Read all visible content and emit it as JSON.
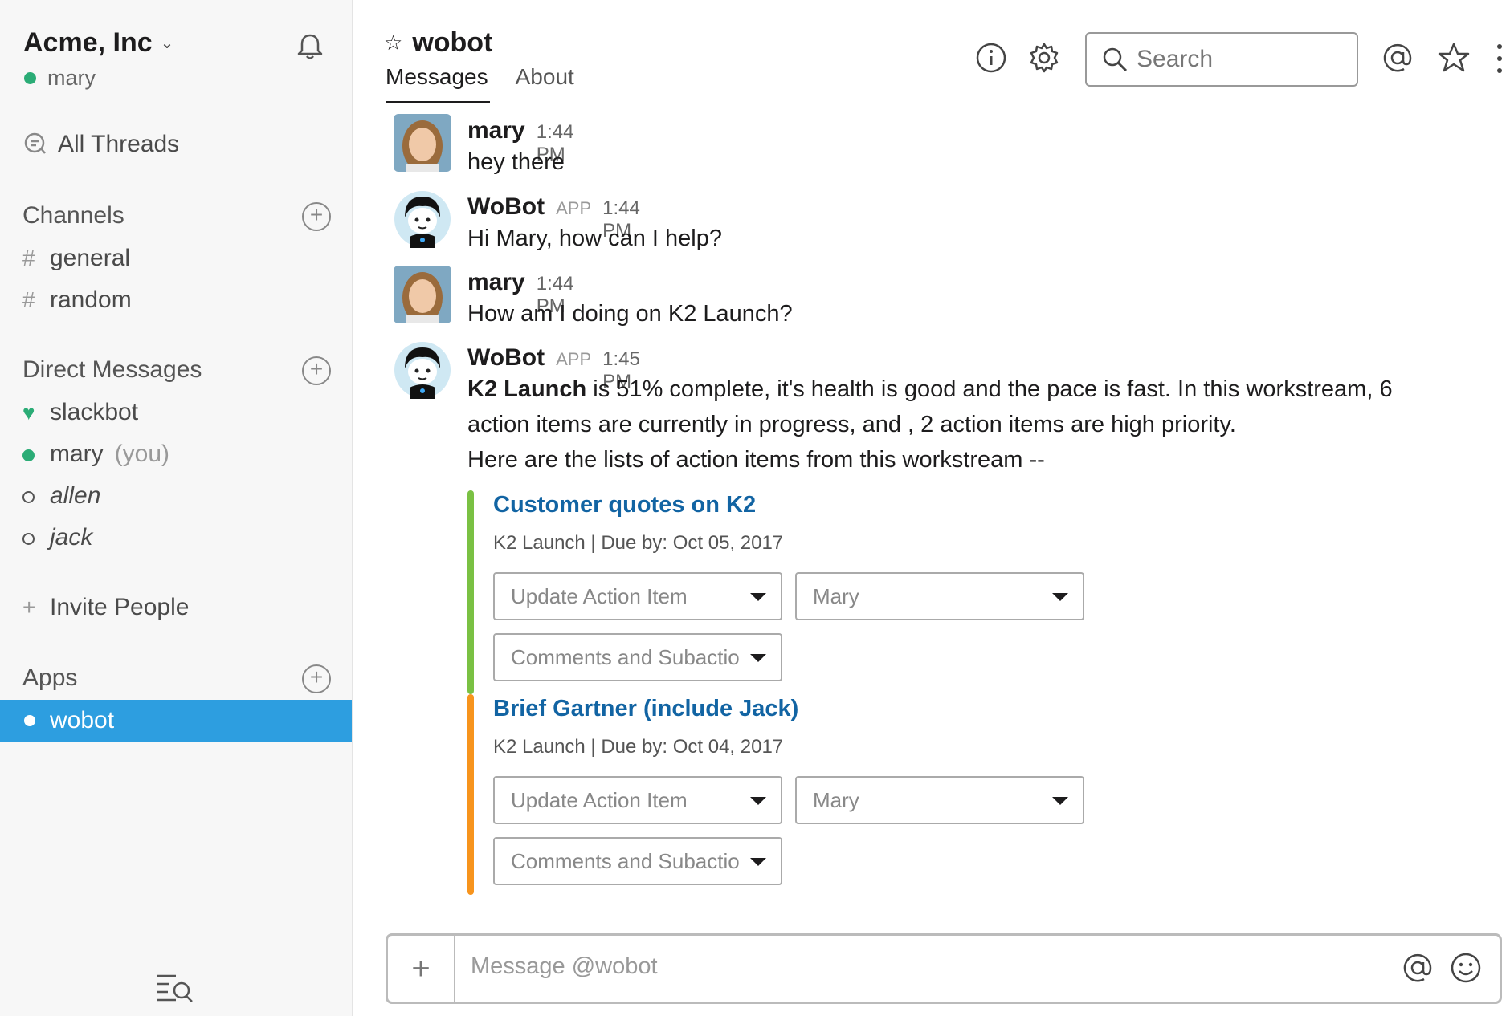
{
  "sidebar": {
    "team_name": "Acme, Inc",
    "team_chevron": "chevron-down-icon",
    "current_user": "mary",
    "all_threads": "All Threads",
    "channels_heading": "Channels",
    "channels": [
      {
        "prefix": "#",
        "name": "general"
      },
      {
        "prefix": "#",
        "name": "random"
      }
    ],
    "dm_heading": "Direct Messages",
    "direct_messages": [
      {
        "name": "slackbot",
        "status": "heart"
      },
      {
        "name": "mary",
        "suffix": "(you)",
        "status": "online"
      },
      {
        "name": "allen",
        "status": "away"
      },
      {
        "name": "jack",
        "status": "away"
      }
    ],
    "invite": "Invite People",
    "invite_prefix": "+",
    "apps_heading": "Apps",
    "apps": [
      {
        "name": "wobot",
        "active": true
      }
    ],
    "colors": {
      "active_bg": "#2d9ee0",
      "online": "#2bac76"
    }
  },
  "header": {
    "channel_name": "wobot",
    "star_glyph": "☆",
    "tabs": [
      {
        "label": "Messages",
        "active": true
      },
      {
        "label": "About",
        "active": false
      }
    ],
    "search_placeholder": "Search",
    "icons": [
      "info-icon",
      "gear-icon",
      "search-icon",
      "at-icon",
      "star-icon",
      "more-icon"
    ]
  },
  "messages": [
    {
      "author": "mary",
      "time": "1:44 PM",
      "text": "hey there"
    },
    {
      "author": "WoBot",
      "app_badge": "APP",
      "time": "1:44 PM",
      "text": "Hi Mary, how can I help?"
    },
    {
      "author": "mary",
      "time": "1:44 PM",
      "text": "How am I doing on K2 Launch?"
    },
    {
      "author": "WoBot",
      "app_badge": "APP",
      "time": "1:45 PM",
      "bold_lead": "K2 Launch",
      "line1_rest": " is 51% complete, it's health is good and the pace is fast. In this workstream, 6",
      "line2": "action items are currently in progress, and , 2 action items are high priority.",
      "line3": "Here are the lists of action items from this workstream --"
    }
  ],
  "attachments": [
    {
      "title": "Customer quotes on K2",
      "subtitle": "K2 Launch | Due by: Oct 05, 2017",
      "bar_color": "#7ac143",
      "select_action": "Update Action Item",
      "select_assignee": "Mary",
      "select_comments": "Comments and Subactions"
    },
    {
      "title": "Brief Gartner (include Jack)",
      "subtitle": "K2 Launch | Due by: Oct 04, 2017",
      "bar_color": "#f7941d",
      "select_action": "Update Action Item",
      "select_assignee": "Mary",
      "select_comments": "Comments and Subactions"
    }
  ],
  "composer": {
    "placeholder": "Message @wobot",
    "plus": "+"
  }
}
